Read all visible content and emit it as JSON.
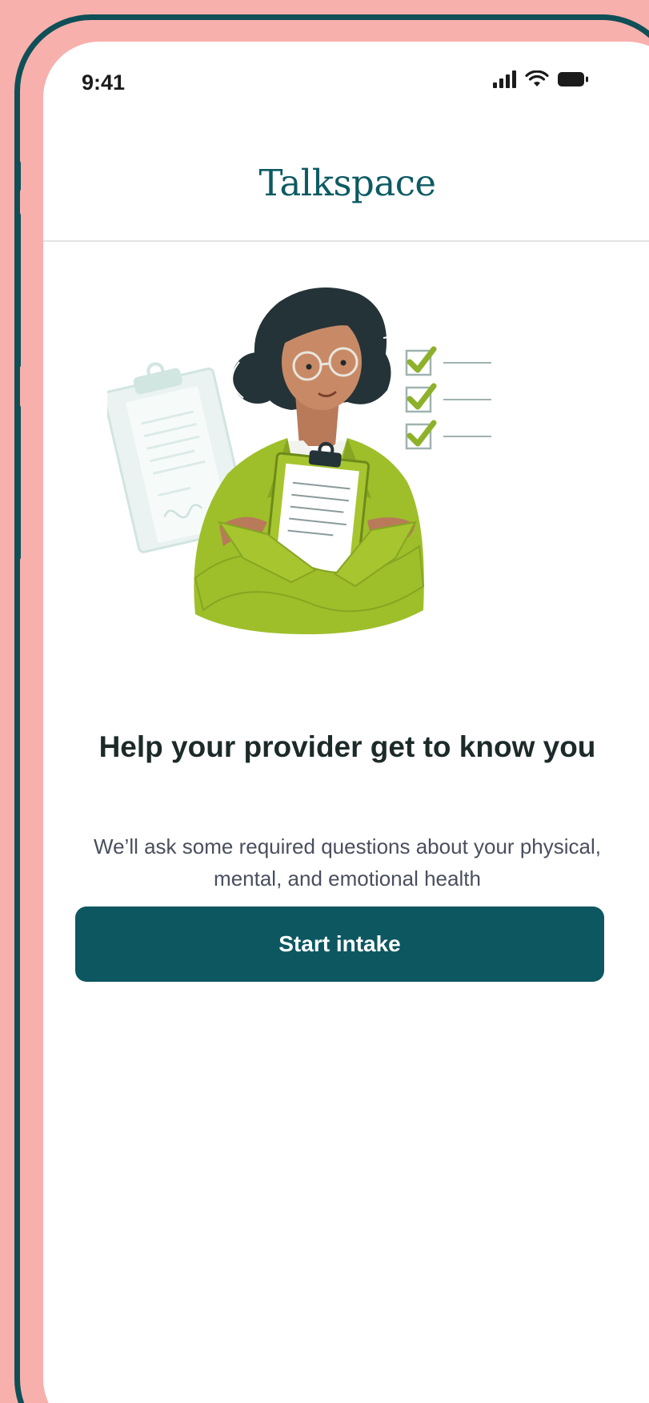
{
  "status_bar": {
    "time": "9:41",
    "icons": [
      "signal-icon",
      "wifi-icon",
      "battery-icon"
    ]
  },
  "header": {
    "brand": "Talkspace"
  },
  "hero": {
    "illustration": "provider-with-clipboard-illustration"
  },
  "main": {
    "title": "Help your provider get to know you",
    "subtitle": "We’ll ask some required questions about your physical, mental, and emotional health",
    "cta_label": "Start intake"
  },
  "colors": {
    "background": "#F8B0AC",
    "frame": "#0F4F57",
    "brand": "#0D5A63",
    "button": "#0D5760",
    "jacket": "#9EBF2A",
    "check": "#8DB12A"
  }
}
